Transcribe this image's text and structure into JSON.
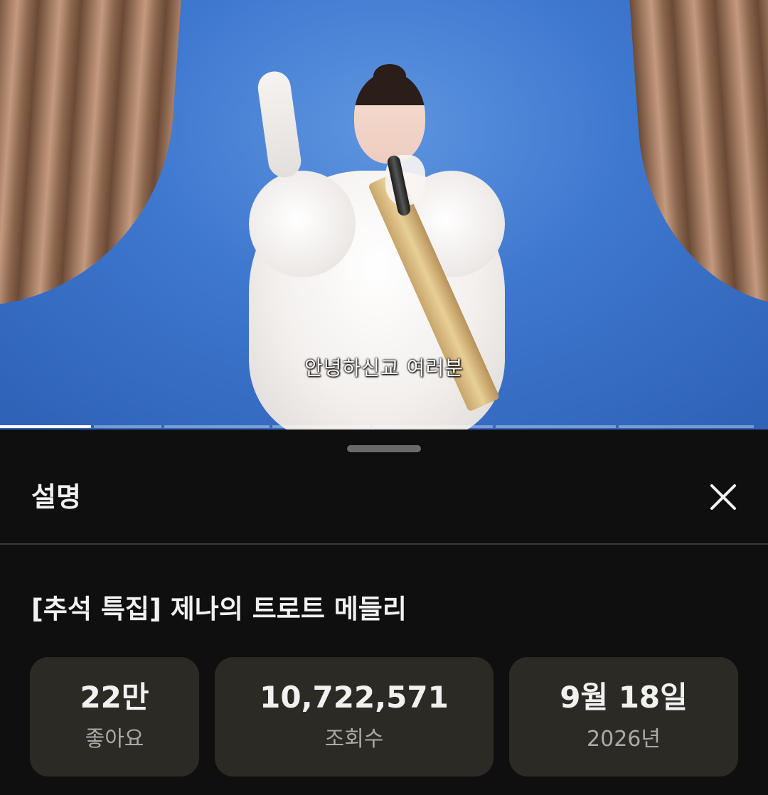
{
  "video": {
    "subtitle": "안녕하신교 여러분",
    "chapter_progress": [
      {
        "width_fraction": 0.121,
        "filled_fraction": 1.0
      },
      {
        "width_fraction": 0.09,
        "filled_fraction": 0.0
      },
      {
        "width_fraction": 0.14,
        "filled_fraction": 0.0
      },
      {
        "width_fraction": 0.13,
        "filled_fraction": 0.0
      },
      {
        "width_fraction": 0.16,
        "filled_fraction": 0.0
      },
      {
        "width_fraction": 0.16,
        "filled_fraction": 0.0
      },
      {
        "width_fraction": 0.18,
        "filled_fraction": 0.0
      }
    ]
  },
  "sheet": {
    "title": "설명",
    "close_icon": "close-icon"
  },
  "description": {
    "video_title": "[추석 특집] 제나의 트로트 메들리",
    "stats": {
      "likes": {
        "value": "22만",
        "label": "좋아요"
      },
      "views": {
        "value": "10,722,571",
        "label": "조회수"
      },
      "date": {
        "value": "9월 18일",
        "label": "2026년"
      }
    }
  },
  "colors": {
    "background": "#0f0f0f",
    "stat_card": "#2b2a24",
    "text_primary": "#f1f1f1",
    "text_secondary": "#aaaaaa"
  }
}
